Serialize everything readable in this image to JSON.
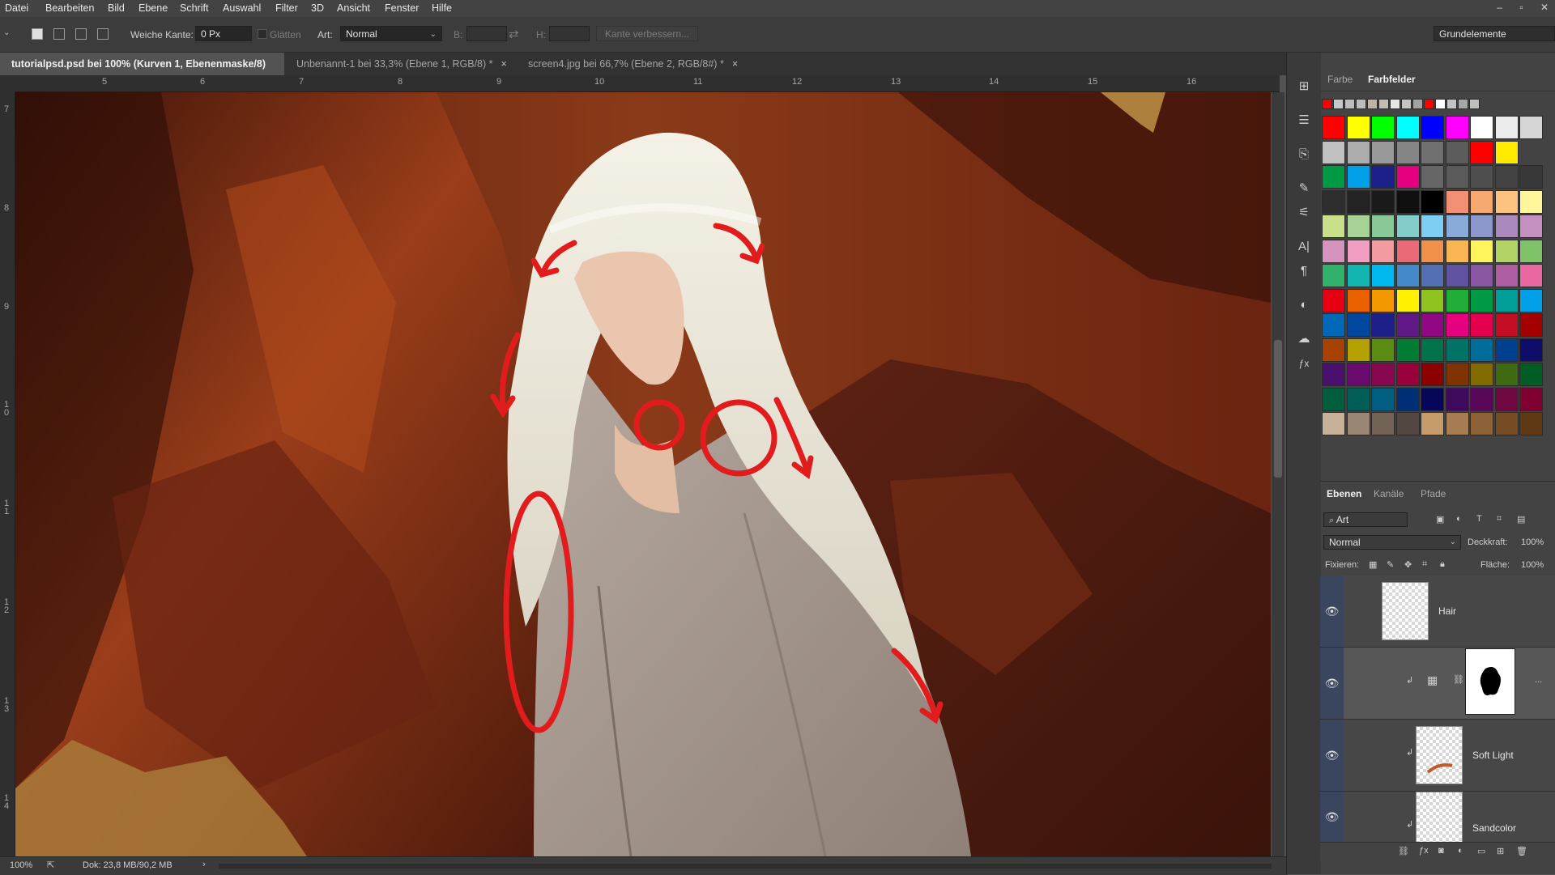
{
  "menu": [
    "Datei",
    "Bearbeiten",
    "Bild",
    "Ebene",
    "Schrift",
    "Auswahl",
    "Filter",
    "3D",
    "Ansicht",
    "Fenster",
    "Hilfe"
  ],
  "window_controls": [
    "–",
    "▫",
    "✕"
  ],
  "options": {
    "soft_edge_label": "Weiche Kante:",
    "soft_edge_value": "0 Px",
    "smooth_label": "Glätten",
    "style_label": "Art:",
    "style_value": "Normal",
    "width_label": "B:",
    "height_label": "H:",
    "refine_edge_button": "Kante verbessern...",
    "workspace": "Grundelemente"
  },
  "tabs": [
    {
      "label": "tutorialpsd.psd bei 100% (Kurven 1, Ebenenmaske/8) *",
      "close": "×",
      "active": true
    },
    {
      "label": "Unbenannt-1 bei 33,3% (Ebene 1, RGB/8) *",
      "close": "×",
      "active": false
    },
    {
      "label": "screen4.jpg bei 66,7% (Ebene 2, RGB/8#) *",
      "close": "×",
      "active": false
    }
  ],
  "ruler_h": [
    "5",
    "6",
    "7",
    "8",
    "9",
    "10",
    "11",
    "12",
    "13",
    "14",
    "15",
    "16"
  ],
  "ruler_v": [
    "7",
    "8",
    "9",
    "10",
    "11",
    "12",
    "13",
    "14"
  ],
  "status": {
    "zoom": "100%",
    "doc": "Dok: 23,8 MB/90,2 MB",
    "arrow": "›"
  },
  "tool_icons": [
    "properties-icon",
    "adjustments-icon",
    "clone-source-icon",
    "brush-preset-icon",
    "sliders-icon",
    "character-icon",
    "paragraph-icon",
    "styles-icon",
    "libraries-icon",
    "fx-icon"
  ],
  "tool_glyphs": [
    "⊞",
    "☰",
    "⎘",
    "✎",
    "⚟",
    "A|",
    "¶",
    "◐",
    "☁",
    "ƒx"
  ],
  "color_panel": {
    "tabs": [
      "Farbe",
      "Farbfelder"
    ],
    "active_tab": "Farbfelder",
    "recent": [
      "#ff0000",
      "#c8c8c8",
      "#bdbdbd",
      "#bcbcbc",
      "#bfb4a3",
      "#c2bcb1",
      "#e6e6e6",
      "#c4c4c4",
      "#a3a3a3",
      "#ff0000",
      "#ffffff",
      "#c3c3c3",
      "#a7a7a7",
      "#bfbfbf"
    ],
    "swatch_rows": [
      [
        "#ff0000",
        "#ffff00",
        "#00ff00",
        "#00ffff",
        "#0000ff",
        "#ff00ff",
        "#ffffff",
        "#ebebeb",
        "#d6d6d6"
      ],
      [
        "#c1c1c1",
        "#adadad",
        "#999999",
        "#858585",
        "#707070",
        "#5c5c5c",
        "#ff0000",
        "#ffea00"
      ],
      [
        "#009944",
        "#00a0e9",
        "#1d2088",
        "#e4007f",
        "#666666",
        "#5a5a5a",
        "#4e4e4e",
        "#434343",
        "#383838"
      ],
      [
        "#2d2d2d",
        "#232323",
        "#1a1a1a",
        "#0f0f0f",
        "#000000",
        "#f19074",
        "#f6a871",
        "#fcc27f",
        "#fff799"
      ],
      [
        "#c9df8a",
        "#a6d395",
        "#89c997",
        "#84ccc9",
        "#7ecef4",
        "#88abda",
        "#8c97cb",
        "#aa89bd",
        "#c490bf"
      ],
      [
        "#d693bd",
        "#f19ec2",
        "#f29c9f",
        "#eb6877",
        "#f19149",
        "#f8b551",
        "#fff45c",
        "#b3d465",
        "#80c269"
      ],
      [
        "#32b16c",
        "#13b5b1",
        "#00b7ee",
        "#448aca",
        "#556fb5",
        "#5f52a0",
        "#8957a1",
        "#ae5da1",
        "#ea68a2"
      ],
      [
        "#e60012",
        "#eb6100",
        "#f39800",
        "#fff100",
        "#8fc31f",
        "#22ac38",
        "#009944",
        "#009e96",
        "#00a0e9"
      ],
      [
        "#0068b7",
        "#00479d",
        "#1d2088",
        "#601986",
        "#920783",
        "#e4007f",
        "#e5004f",
        "#c30d23",
        "#a40000"
      ],
      [
        "#a84200",
        "#b5a200",
        "#5b8c14",
        "#007d32",
        "#00734d",
        "#007366",
        "#006c9a",
        "#00408e",
        "#0f0d6a"
      ],
      [
        "#4b0f6e",
        "#6b0a6e",
        "#87084f",
        "#99003c",
        "#8c0000",
        "#7e3300",
        "#826c00",
        "#3e6b12",
        "#005e25"
      ],
      [
        "#005e3e",
        "#005e57",
        "#005e80",
        "#002f75",
        "#07075a",
        "#3f0a5b",
        "#590859",
        "#700842",
        "#810032"
      ],
      [
        "#c7b299",
        "#998675",
        "#736357",
        "#534741",
        "#c69c6d",
        "#a67c52",
        "#8c6239",
        "#754c24",
        "#603813"
      ]
    ]
  },
  "layers_panel": {
    "tabs": [
      "Ebenen",
      "Kanäle",
      "Pfade"
    ],
    "active_tab": "Ebenen",
    "filter_label": "Art",
    "blend_mode": "Normal",
    "opacity_label": "Deckkraft:",
    "opacity_value": "100%",
    "lock_label": "Fixieren:",
    "fill_label": "Fläche:",
    "fill_value": "100%",
    "layers": [
      {
        "name": "Hair",
        "visible": true
      },
      {
        "name": "",
        "visible": true,
        "selected": true
      },
      {
        "name": "Soft Light",
        "visible": true
      },
      {
        "name": "Sandcolor",
        "visible": true
      }
    ],
    "more": "..."
  }
}
